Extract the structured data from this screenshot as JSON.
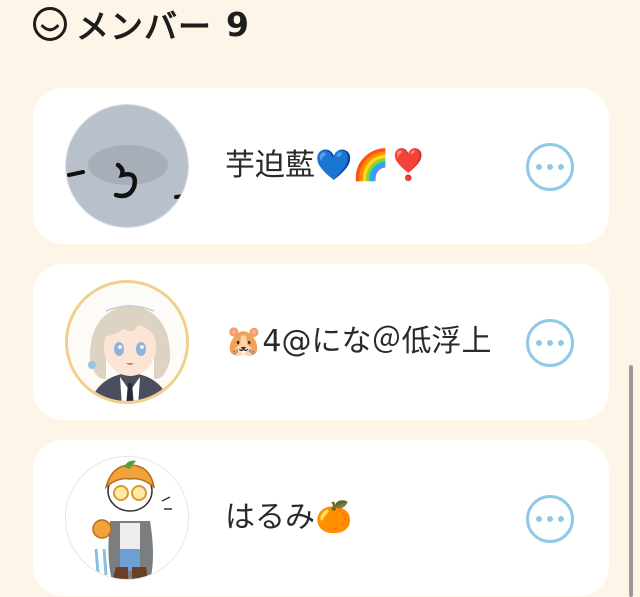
{
  "header": {
    "icon": "smile-icon",
    "title": "メンバー",
    "count": "9"
  },
  "members": [
    {
      "name": "芋迫藍💙🌈❣️",
      "avatar": "gray-avatar-with-ra",
      "more_icon": "more-icon"
    },
    {
      "name": "🐹4@にな＠低浮上",
      "avatar": "anime-girl-avatar",
      "more_icon": "more-icon"
    },
    {
      "name": "はるみ🍊",
      "avatar": "orange-character-avatar",
      "more_icon": "more-icon"
    }
  ],
  "colors": {
    "background": "#fdf6e8",
    "card": "#ffffff",
    "accent": "#8ec9e6",
    "text": "#2a2a2a"
  }
}
